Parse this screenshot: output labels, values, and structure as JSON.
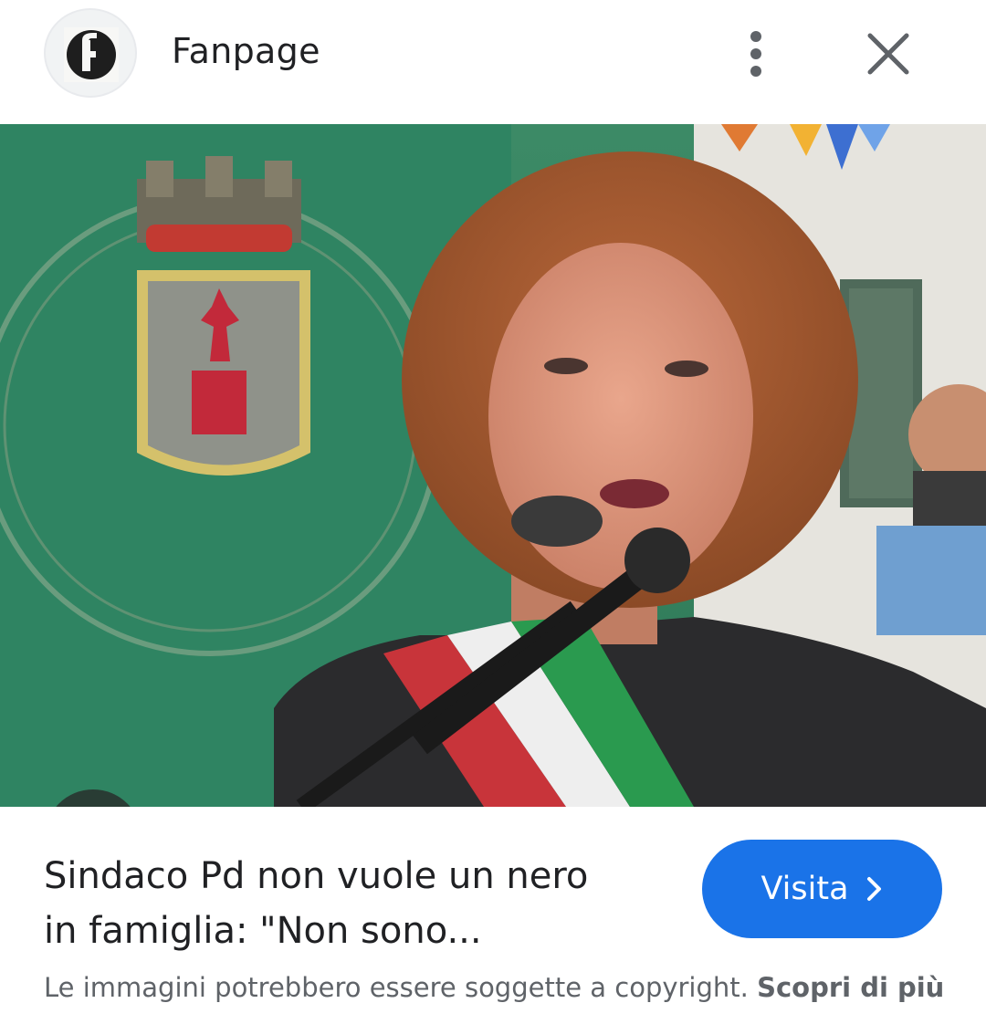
{
  "header": {
    "site_name": "Fanpage",
    "logo_icon": "fanpage-logo-icon",
    "more_icon": "more-vertical-icon",
    "close_icon": "close-icon"
  },
  "hero": {
    "lens_icon": "google-lens-icon"
  },
  "result": {
    "title_line1": "Sindaco Pd non vuole un nero",
    "title_line2": "in famiglia: \"Non sono...",
    "visit_label": "Visita",
    "visit_icon": "chevron-right-icon",
    "copyright_text": "Le immagini potrebbero essere soggette a copyright.",
    "learn_more_link": "Scopri di più"
  },
  "colors": {
    "accent": "#1a73e8",
    "text_primary": "#202124",
    "text_secondary": "#5f6368"
  }
}
